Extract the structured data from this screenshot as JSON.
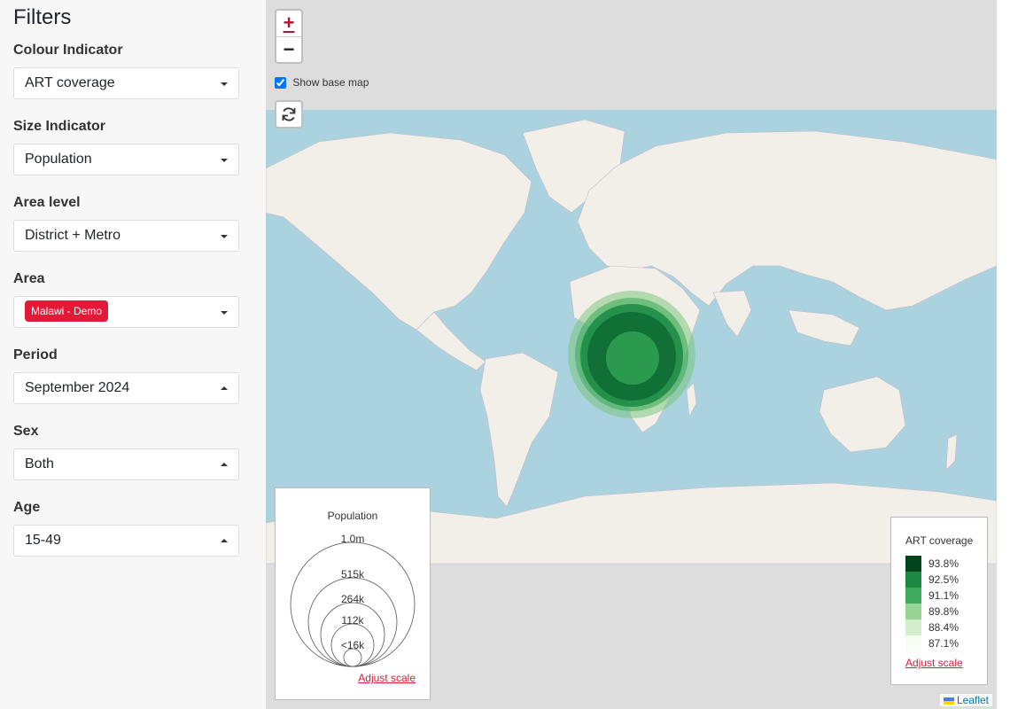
{
  "sidebar": {
    "title": "Filters",
    "filters": [
      {
        "label": "Colour Indicator",
        "value": "ART coverage"
      },
      {
        "label": "Size Indicator",
        "value": "Population"
      },
      {
        "label": "Area level",
        "value": "District + Metro"
      },
      {
        "label": "Area",
        "chip": "Malawi - Demo"
      },
      {
        "label": "Period",
        "value": "September 2024"
      },
      {
        "label": "Sex",
        "value": "Both"
      },
      {
        "label": "Age",
        "value": "15-49"
      }
    ]
  },
  "map": {
    "zoom_in": "+",
    "zoom_out": "−",
    "show_base_map_label": "Show base map",
    "show_base_map_checked": true,
    "refresh_icon": "refresh-icon",
    "attribution": "Leaflet"
  },
  "size_legend": {
    "title": "Population",
    "labels": [
      "1.0m",
      "515k",
      "264k",
      "112k",
      "<16k"
    ],
    "adjust": "Adjust scale"
  },
  "colour_legend": {
    "title": "ART coverage",
    "entries": [
      {
        "label": "93.8%",
        "color": "#00441b"
      },
      {
        "label": "92.5%",
        "color": "#1a8a43"
      },
      {
        "label": "91.1%",
        "color": "#41ab5d"
      },
      {
        "label": "89.8%",
        "color": "#98d594"
      },
      {
        "label": "88.4%",
        "color": "#d3eecd"
      },
      {
        "label": "87.1%",
        "color": "#f7fcf5"
      }
    ],
    "adjust": "Adjust scale"
  }
}
